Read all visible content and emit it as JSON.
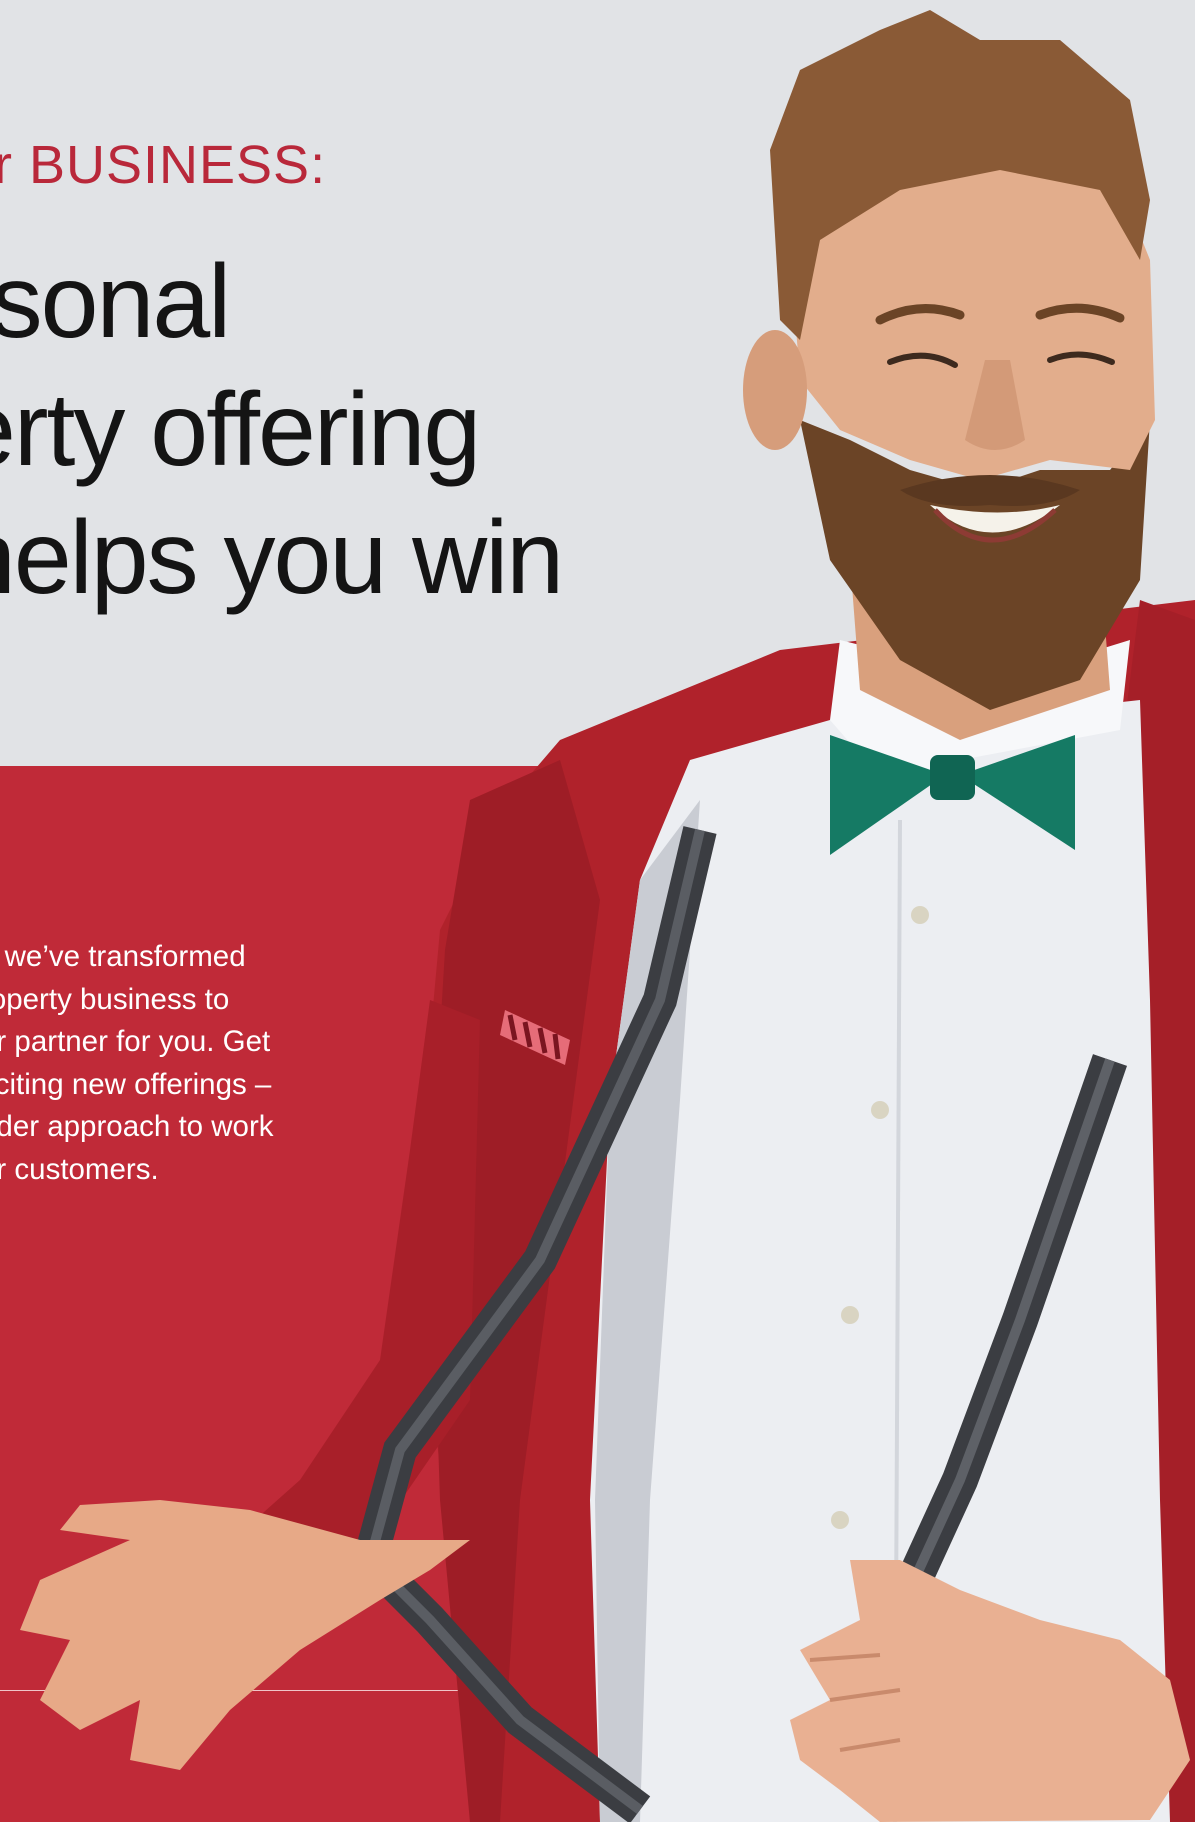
{
  "eyebrow": "r BUSINESS:",
  "headline": {
    "lines": [
      "rsonal",
      "erty offering",
      "helps you win"
    ]
  },
  "body": {
    "lines": [
      "e we’ve transformed",
      "roperty business to",
      "er partner for you. Get",
      "xciting new offerings –",
      "ader approach to work",
      "ur customers."
    ]
  },
  "colors": {
    "top_background": "#e1e3e6",
    "brand_red": "#c02a38",
    "eyebrow_red": "#b9283a",
    "headline_text": "#141414",
    "body_text": "#ffffff"
  },
  "photo": {
    "subject": "smiling bearded man in red blazer, white shirt, green bow tie and suspenders"
  }
}
